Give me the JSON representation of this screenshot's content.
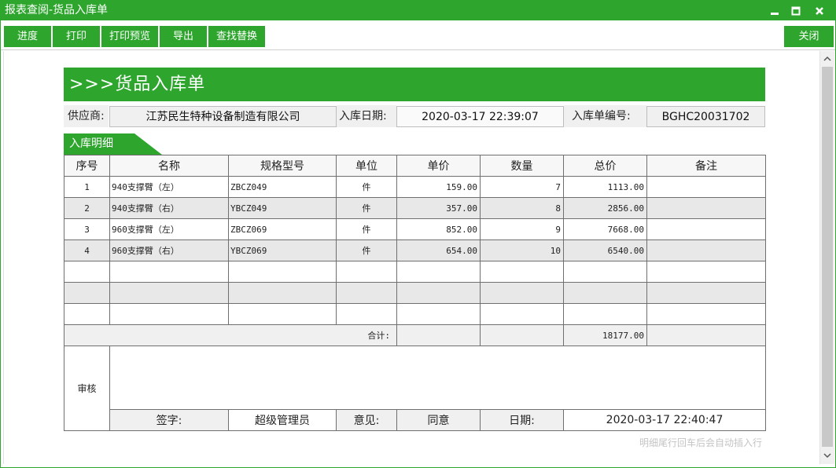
{
  "window": {
    "title": "报表查阅-货品入库单",
    "controls": [
      "minimize-icon",
      "maximize-icon",
      "close-icon"
    ]
  },
  "toolbar": {
    "buttons": [
      {
        "label": "进度"
      },
      {
        "label": "打印"
      },
      {
        "label": "打印预览"
      },
      {
        "label": "导出"
      },
      {
        "label": "查找替换"
      }
    ],
    "close_label": "关闭"
  },
  "form": {
    "banner": ">>>货品入库单",
    "supplier_label": "供应商:",
    "supplier_value": "江苏民生特种设备制造有限公司",
    "date_label": "入库日期:",
    "date_value": "2020-03-17 22:39:07",
    "number_label": "入库单编号:",
    "number_value": "BGHC20031702",
    "detail_tab": "入库明细"
  },
  "table": {
    "columns": [
      "序号",
      "名称",
      "规格型号",
      "单位",
      "单价",
      "数量",
      "总价",
      "备注"
    ],
    "rows": [
      {
        "no": "1",
        "name": "940支撑臂（左）",
        "spec": "ZBCZ049",
        "unit": "件",
        "price": "159.00",
        "qty": "7",
        "total": "1113.00",
        "note": ""
      },
      {
        "no": "2",
        "name": "940支撑臂（右）",
        "spec": "YBCZ049",
        "unit": "件",
        "price": "357.00",
        "qty": "8",
        "total": "2856.00",
        "note": ""
      },
      {
        "no": "3",
        "name": "960支撑臂（左）",
        "spec": "ZBCZ069",
        "unit": "件",
        "price": "852.00",
        "qty": "9",
        "total": "7668.00",
        "note": ""
      },
      {
        "no": "4",
        "name": "960支撑臂（右）",
        "spec": "YBCZ069",
        "unit": "件",
        "price": "654.00",
        "qty": "10",
        "total": "6540.00",
        "note": ""
      }
    ],
    "total_label": "合计:",
    "total_value": "18177.00"
  },
  "audit": {
    "section_label": "审核",
    "sign_label": "签字:",
    "sign_value": "超级管理员",
    "opinion_label": "意见:",
    "opinion_value": "同意",
    "date_label": "日期:",
    "date_value": "2020-03-17 22:40:47"
  },
  "footnote": "明细尾行回车后会自动插入行",
  "colors": {
    "accent": "#2ea62e",
    "row_alt": "#e8e8e8",
    "field_bg": "#f0f0f0"
  }
}
